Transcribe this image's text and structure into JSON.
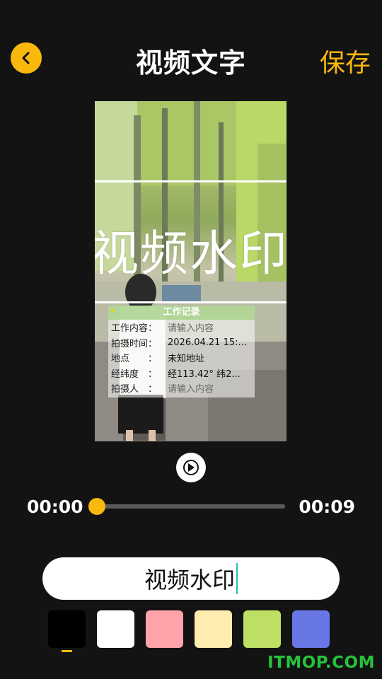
{
  "header": {
    "title": "视频文字",
    "save_label": "保存",
    "back_icon": "chevron-left-icon"
  },
  "preview": {
    "watermark_text": "视频水印",
    "record": {
      "title": "工作记录",
      "rows": [
        {
          "label": "工作内容：",
          "value": "请输入内容",
          "placeholder": true
        },
        {
          "label": "拍摄时间：",
          "value": "2026.04.21 15:...",
          "placeholder": false
        },
        {
          "label": "地点　　：",
          "value": "未知地址",
          "placeholder": false
        },
        {
          "label": "经纬度　：",
          "value": "经113.42° 纬2...",
          "placeholder": false
        },
        {
          "label": "拍摄人　：",
          "value": "请输入内容",
          "placeholder": true
        }
      ]
    }
  },
  "player": {
    "current_time": "00:00",
    "total_time": "00:09",
    "progress": 0,
    "play_icon": "play-icon"
  },
  "editor": {
    "text_value": "视频水印"
  },
  "colors": {
    "accent": "#f9b90c",
    "swatches": [
      "#000000",
      "#ffffff",
      "#ffa3aa",
      "#ffecb0",
      "#bde064",
      "#6876e6"
    ],
    "selected_index": 0
  },
  "site_mark": "ITMOP.COM"
}
